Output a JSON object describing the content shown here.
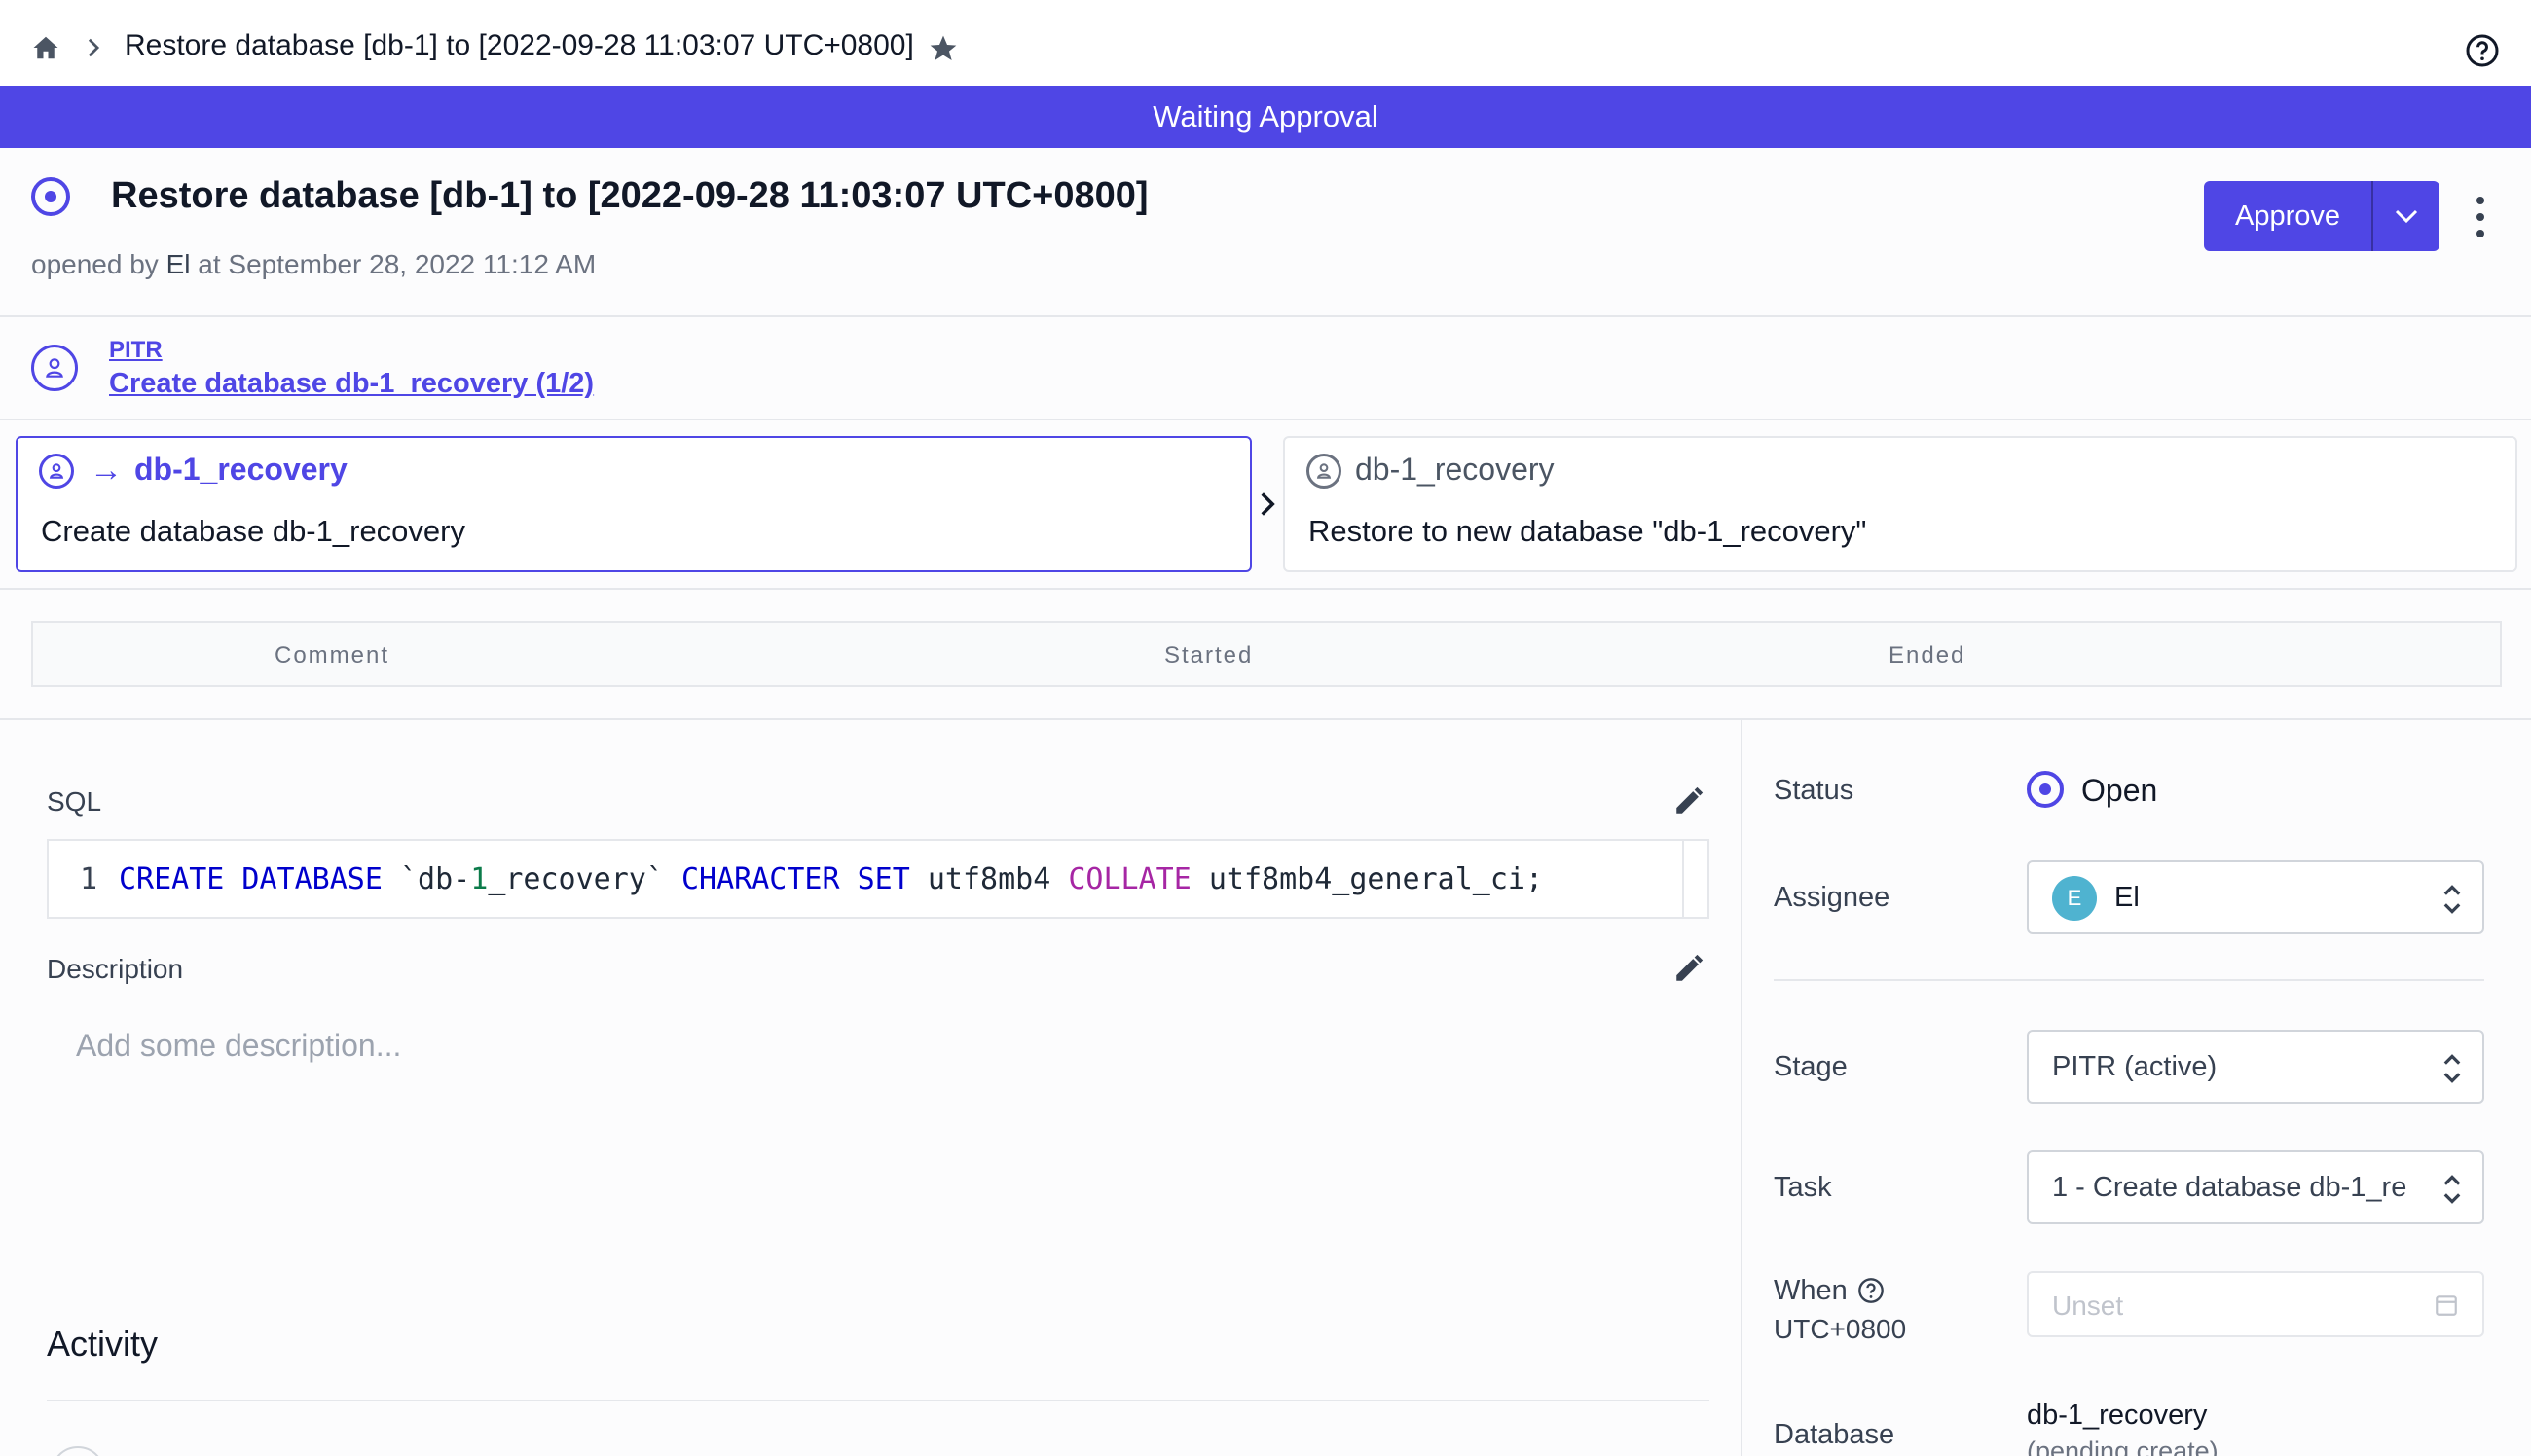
{
  "breadcrumb": {
    "title": "Restore database [db-1] to [2022-09-28 11:03:07 UTC+0800]"
  },
  "banner": {
    "text": "Waiting Approval"
  },
  "issue": {
    "title": "Restore database [db-1] to [2022-09-28 11:03:07 UTC+0800]",
    "opened_prefix": "opened by",
    "opened_by": "El",
    "opened_suffix": "at September 28, 2022 11:12 AM"
  },
  "actions": {
    "approve_label": "Approve"
  },
  "pipeline": {
    "stage_link": "PITR",
    "task_link": "Create database db-1_recovery (1/2)",
    "tasks": [
      {
        "arrow": "→",
        "database": "db-1_recovery",
        "name": "Create database db-1_recovery",
        "active": true
      },
      {
        "database": "db-1_recovery",
        "name": "Restore to new database \"db-1_recovery\"",
        "active": false
      }
    ]
  },
  "run_table": {
    "columns": [
      "Comment",
      "Started",
      "Ended"
    ]
  },
  "sql": {
    "label": "SQL",
    "line_number": "1",
    "tokens": [
      {
        "text": "CREATE DATABASE",
        "cls": "kw"
      },
      {
        "text": " `db-",
        "cls": "plain"
      },
      {
        "text": "1",
        "cls": "num"
      },
      {
        "text": "_recovery` ",
        "cls": "plain"
      },
      {
        "text": "CHARACTER SET",
        "cls": "kw"
      },
      {
        "text": " utf8mb4 ",
        "cls": "plain"
      },
      {
        "text": "COLLATE",
        "cls": "kw2"
      },
      {
        "text": " utf8mb4_general_ci;",
        "cls": "plain"
      }
    ]
  },
  "description": {
    "label": "Description",
    "placeholder": "Add some description..."
  },
  "activity": {
    "label": "Activity"
  },
  "sidebar": {
    "status_label": "Status",
    "status_value": "Open",
    "assignee_label": "Assignee",
    "assignee_initial": "E",
    "assignee_name": "El",
    "stage_label": "Stage",
    "stage_value": "PITR (active)",
    "task_label": "Task",
    "task_value": "1 - Create database db-1_re",
    "when_label": "When",
    "when_tz": "UTC+0800",
    "when_placeholder": "Unset",
    "database_label": "Database",
    "database_name": "db-1_recovery",
    "database_note": "(pending create)"
  },
  "colors": {
    "accent": "#4f46e5",
    "avatar": "#4fb3d0"
  }
}
